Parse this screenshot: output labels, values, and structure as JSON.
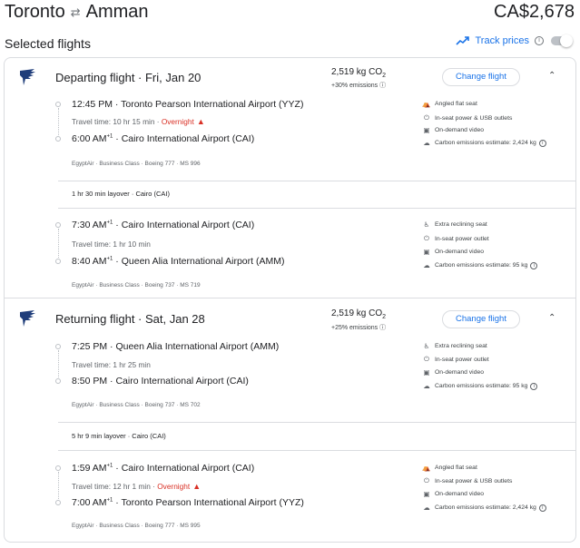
{
  "header": {
    "origin": "Toronto",
    "destination": "Amman",
    "swap_icon": "swap-arrows-icon",
    "price": "CA$2,678"
  },
  "selected": {
    "title": "Selected flights",
    "track_label": "Track prices",
    "track_enabled": false
  },
  "departing": {
    "title": "Departing flight · Fri, Jan 20",
    "co2_value": "2,519 kg CO",
    "co2_sub": "2",
    "emissions_note": "+30% emissions",
    "change_label": "Change flight",
    "collapse_icon": "chevron-up-icon",
    "leg1": {
      "dep_time": "12:45 PM",
      "dep_airport": "Toronto Pearson International Airport (YYZ)",
      "travel_time": "Travel time: 10 hr 15 min",
      "overnight": "Overnight",
      "arr_time": "6:00 AM",
      "arr_plus": "+1",
      "arr_airport": "Cairo International Airport (CAI)",
      "meta": "EgyptAir · Business Class · Boeing 777 · MS 996",
      "amenities": [
        {
          "icon": "seat-icon",
          "label": "Angled flat seat"
        },
        {
          "icon": "power-plug-icon",
          "label": "In-seat power & USB outlets"
        },
        {
          "icon": "video-icon",
          "label": "On-demand video"
        },
        {
          "icon": "co2-icon",
          "label": "Carbon emissions estimate: 2,424 kg"
        }
      ]
    },
    "layover": "1 hr 30 min layover · Cairo (CAI)",
    "leg2": {
      "dep_time": "7:30 AM",
      "dep_plus": "+1",
      "dep_airport": "Cairo International Airport (CAI)",
      "travel_time": "Travel time: 1 hr 10 min",
      "arr_time": "8:40 AM",
      "arr_plus": "+1",
      "arr_airport": "Queen Alia International Airport (AMM)",
      "meta": "EgyptAir · Business Class · Boeing 737 · MS 719",
      "amenities": [
        {
          "icon": "reclining-seat-icon",
          "label": "Extra reclining seat"
        },
        {
          "icon": "power-plug-icon",
          "label": "In-seat power outlet"
        },
        {
          "icon": "video-icon",
          "label": "On-demand video"
        },
        {
          "icon": "co2-icon",
          "label": "Carbon emissions estimate: 95 kg"
        }
      ]
    }
  },
  "returning": {
    "title": "Returning flight · Sat, Jan 28",
    "co2_value": "2,519 kg CO",
    "co2_sub": "2",
    "emissions_note": "+25% emissions",
    "change_label": "Change flight",
    "collapse_icon": "chevron-up-icon",
    "leg1": {
      "dep_time": "7:25 PM",
      "dep_airport": "Queen Alia International Airport (AMM)",
      "travel_time": "Travel time: 1 hr 25 min",
      "arr_time": "8:50 PM",
      "arr_airport": "Cairo International Airport (CAI)",
      "meta": "EgyptAir · Business Class · Boeing 737 · MS 702",
      "amenities": [
        {
          "icon": "reclining-seat-icon",
          "label": "Extra reclining seat"
        },
        {
          "icon": "power-plug-icon",
          "label": "In-seat power outlet"
        },
        {
          "icon": "video-icon",
          "label": "On-demand video"
        },
        {
          "icon": "co2-icon",
          "label": "Carbon emissions estimate: 95 kg"
        }
      ]
    },
    "layover": "5 hr 9 min layover · Cairo (CAI)",
    "leg2": {
      "dep_time": "1:59 AM",
      "dep_plus": "+1",
      "dep_airport": "Cairo International Airport (CAI)",
      "travel_time": "Travel time: 12 hr 1 min",
      "overnight": "Overnight",
      "arr_time": "7:00 AM",
      "arr_plus": "+1",
      "arr_airport": "Toronto Pearson International Airport (YYZ)",
      "meta": "EgyptAir · Business Class · Boeing 777 · MS 995",
      "amenities": [
        {
          "icon": "seat-icon",
          "label": "Angled flat seat"
        },
        {
          "icon": "power-plug-icon",
          "label": "In-seat power & USB outlets"
        },
        {
          "icon": "video-icon",
          "label": "On-demand video"
        },
        {
          "icon": "co2-icon",
          "label": "Carbon emissions estimate: 2,424 kg"
        }
      ]
    }
  },
  "colors": {
    "accent": "#1a73e8",
    "warning": "#d93025",
    "border": "#dadce0",
    "text": "#202124",
    "muted": "#5f6368"
  }
}
